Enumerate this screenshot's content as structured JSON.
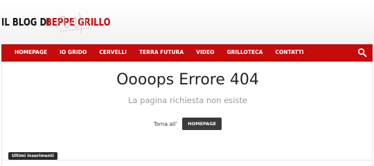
{
  "header": {
    "logo_prefix": "IL BLOG DI",
    "logo_name": "BEPPE GRILLO"
  },
  "nav": {
    "items": [
      {
        "label": "HOMEPAGE"
      },
      {
        "label": "IO GRIDO"
      },
      {
        "label": "CERVELLI"
      },
      {
        "label": "TERRA FUTURA"
      },
      {
        "label": "VIDEO"
      },
      {
        "label": "GRILLOTECA"
      },
      {
        "label": "CONTATTI"
      }
    ],
    "search_icon": "search-icon"
  },
  "error": {
    "title": "Oooops Errore 404",
    "subtitle": "La pagina richiesta non esiste",
    "back_label": "Torna all'",
    "home_button": "HOMEPAGE"
  },
  "latest": {
    "label": "Ultimi inserimenti"
  },
  "colors": {
    "brand_red": "#c50b0b",
    "button_dark": "#3b3b3b"
  }
}
